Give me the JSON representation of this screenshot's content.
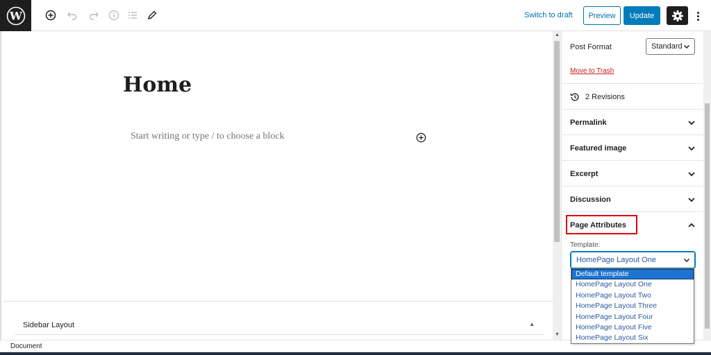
{
  "toolbar": {
    "switch_draft": "Switch to draft",
    "preview": "Preview",
    "update": "Update"
  },
  "editor": {
    "post_title": "Home",
    "block_placeholder": "Start writing or type / to choose a block"
  },
  "meta_box": {
    "title": "Sidebar Layout"
  },
  "sidebar": {
    "post_format_label": "Post Format",
    "post_format_value": "Standard",
    "move_to_trash": "Move to Trash",
    "revisions": "2 Revisions",
    "panels": {
      "permalink": "Permalink",
      "featured_image": "Featured image",
      "excerpt": "Excerpt",
      "discussion": "Discussion",
      "page_attributes": "Page Attributes"
    },
    "template_label": "Template:",
    "template_value": "HomePage Layout One",
    "template_options": [
      "Default template",
      "HomePage Layout One",
      "HomePage Layout Two",
      "HomePage Layout Three",
      "HomePage Layout Four",
      "HomePage Layout Five",
      "HomePage Layout Six"
    ]
  },
  "footer": {
    "breadcrumb": "Document"
  },
  "colors": {
    "accent": "#007cba",
    "link": "#0073aa",
    "danger": "#cc1818",
    "highlight": "#e0000d",
    "dark": "#1e1e1e"
  }
}
